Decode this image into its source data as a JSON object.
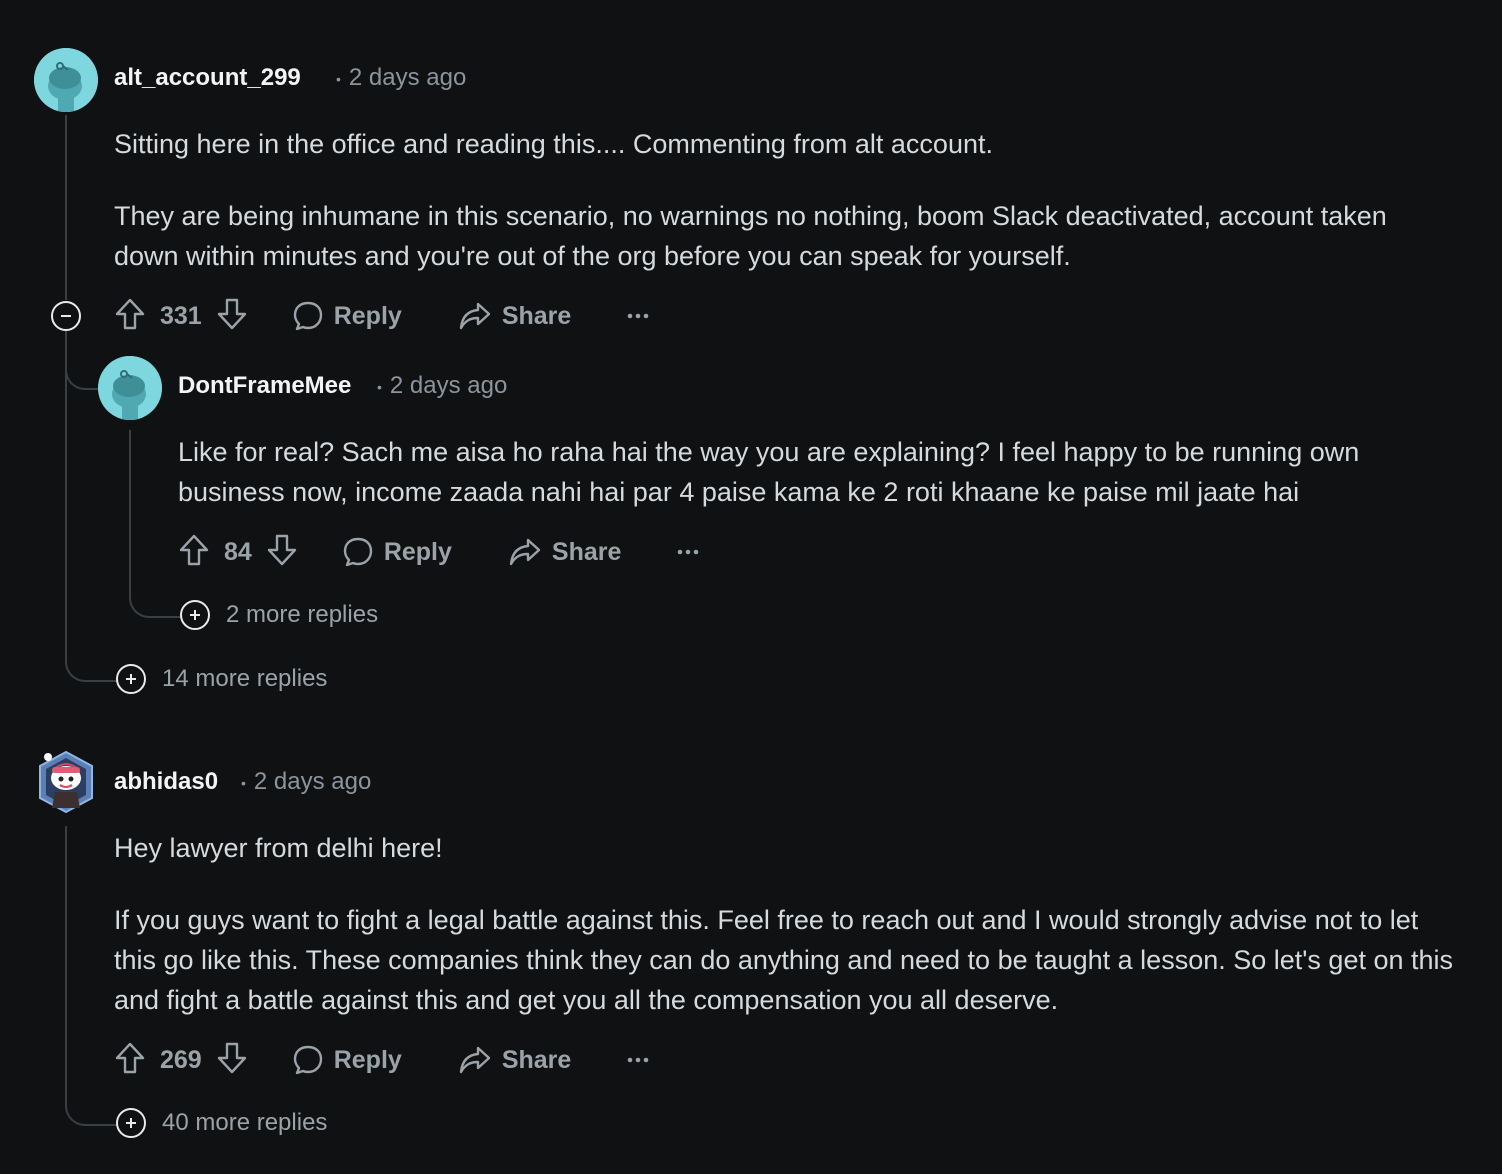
{
  "comments": [
    {
      "username": "alt_account_299",
      "time": "2 days ago",
      "paragraphs": [
        "Sitting here in the office and reading this.... Commenting from alt account.",
        "They are being inhumane in this scenario, no warnings no nothing, boom Slack deactivated, account taken down within minutes and you're out of the org before you can speak for yourself."
      ],
      "votes": "331",
      "more_replies": "14 more replies",
      "reply": {
        "username": "DontFrameMee",
        "time": "2 days ago",
        "paragraphs": [
          "Like for real? Sach me aisa ho raha hai the way you are explaining? I feel happy to be running own business now, income zaada nahi hai par 4 paise kama ke 2 roti khaane ke paise mil jaate hai"
        ],
        "votes": "84",
        "more_replies": "2 more replies"
      }
    },
    {
      "username": "abhidas0",
      "time": "2 days ago",
      "paragraphs": [
        "Hey lawyer from delhi here!",
        "If you guys want to fight a legal battle against this. Feel free to reach out and I would strongly advise not to let this go like this. These companies think they can do anything and need to be taught a lesson. So let's get on this and fight a battle against this and get you all the compensation you all deserve."
      ],
      "votes": "269",
      "more_replies": "40 more replies"
    }
  ],
  "labels": {
    "reply": "Reply",
    "share": "Share",
    "dot": "•"
  },
  "colors": {
    "background": "#0f1113",
    "avatar": "#7ed6df",
    "thread_line": "#3a3f43"
  }
}
